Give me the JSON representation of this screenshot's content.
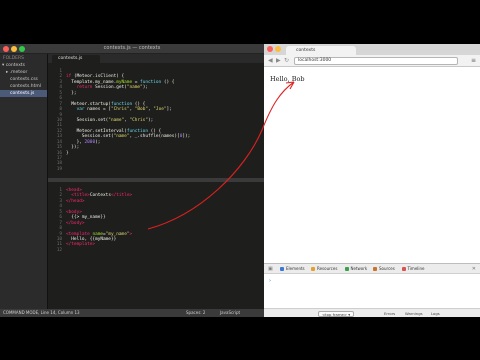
{
  "editor": {
    "title": "contexts.js — contexts",
    "tab_label": "contexts.js",
    "sidebar": {
      "folders_label": "FOLDERS",
      "items": [
        {
          "label": "▾ contexts",
          "indent": 2,
          "active": false
        },
        {
          "label": "▸ .meteor",
          "indent": 6,
          "active": false
        },
        {
          "label": "contexts.css",
          "indent": 10,
          "active": false
        },
        {
          "label": "contexts.html",
          "indent": 10,
          "active": false
        },
        {
          "label": "contexts.js",
          "indent": 10,
          "active": true
        }
      ]
    },
    "status": {
      "left": "COMMAND MODE, Line 14, Column 13",
      "spaces": "Spaces: 2",
      "syntax": "JavaScript"
    }
  },
  "browser": {
    "tab_title": "contexts",
    "url": "localhost:3000",
    "page_text": "Hello, Bob",
    "devtools": {
      "panels": [
        {
          "label": "Elements",
          "color": "#3b78d8"
        },
        {
          "label": "Resources",
          "color": "#e5a12b"
        },
        {
          "label": "Network",
          "color": "#3aa14c"
        },
        {
          "label": "Sources",
          "color": "#c9732c"
        },
        {
          "label": "Timeline",
          "color": "#d9534f"
        }
      ],
      "frame_select": "<top frame> ▾",
      "filters": [
        "Errors",
        "Warnings",
        "Logs"
      ]
    }
  }
}
